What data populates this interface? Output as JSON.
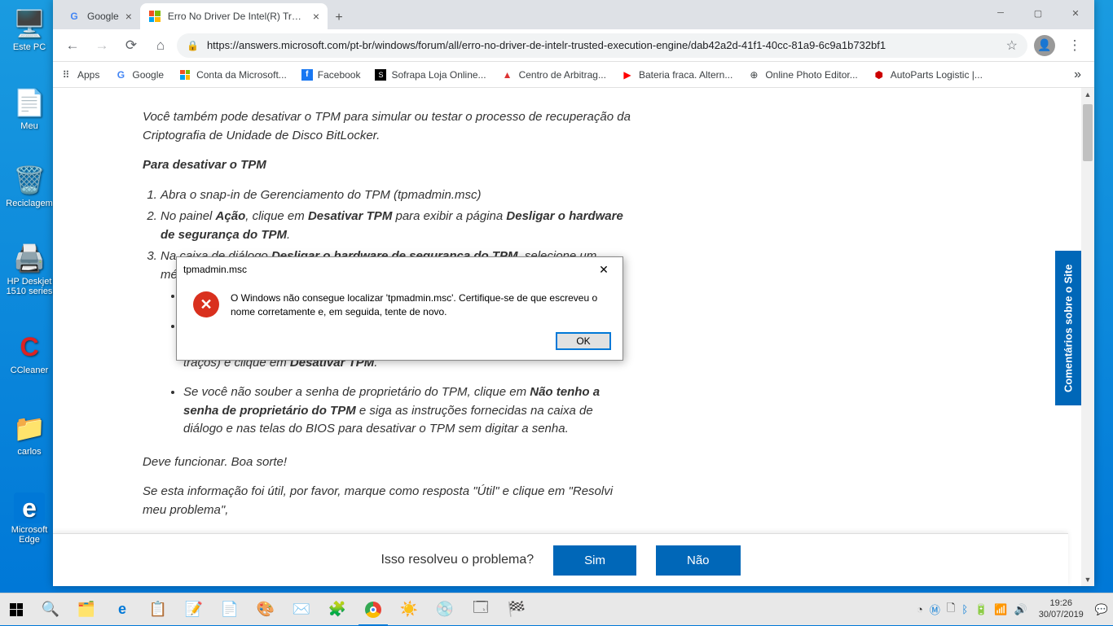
{
  "desktop_icons": [
    {
      "label": "Este PC",
      "glyph": "🖥️"
    },
    {
      "label": "Meu",
      "glyph": "📄"
    },
    {
      "label": "Reciclagem",
      "glyph": "🗑️"
    },
    {
      "label": "HP Deskjet 1510 series",
      "glyph": "🖨️"
    },
    {
      "label": "CCleaner",
      "glyph": "🧹"
    },
    {
      "label": "carlos",
      "glyph": "📁"
    },
    {
      "label": "Microsoft Edge",
      "glyph": "e"
    }
  ],
  "tabs": [
    {
      "title": "Google",
      "favicon": "G",
      "active": false
    },
    {
      "title": "Erro No Driver De Intel(R) Trustec",
      "favicon": "⊞",
      "active": true
    }
  ],
  "toolbar": {
    "url": "https://answers.microsoft.com/pt-br/windows/forum/all/erro-no-driver-de-intelr-trusted-execution-engine/dab42a2d-41f1-40cc-81a9-6c9a1b732bf1"
  },
  "bookmarks": [
    {
      "label": "Apps",
      "icon": "⠿"
    },
    {
      "label": "Google",
      "icon": "G"
    },
    {
      "label": "Conta da Microsoft...",
      "icon": "⊞"
    },
    {
      "label": "Facebook",
      "icon": "f"
    },
    {
      "label": "Sofrapa Loja Online...",
      "icon": "S"
    },
    {
      "label": "Centro de Arbitrag...",
      "icon": "▲"
    },
    {
      "label": "Bateria fraca. Altern...",
      "icon": "▶"
    },
    {
      "label": "Online Photo Editor...",
      "icon": "⊕"
    },
    {
      "label": "AutoParts Logistic |...",
      "icon": "⬢"
    }
  ],
  "article": {
    "p1": "Você também pode desativar o TPM para simular ou testar o processo de recuperação da Criptografia de Unidade de Disco BitLocker.",
    "h1": "Para desativar o TPM",
    "ol": [
      "Abra o snap-in de Gerenciamento do TPM (tpmadmin.msc)",
      "No painel <b>Ação</b>, clique em <b>Desativar TPM</b> para exibir a página <b>Desligar o hardware de segurança do TPM</b>.",
      "Na caixa de diálogo <b>Desligar o hardware de segurança do TPM</b>, selecione um método para inserir sua ... TPM."
    ],
    "bullets": [
      "... -a e clique ... de diálogo ... <b>rar</b> para ... <b>ativar TPM</b>.",
      "... clique em <b>Desejo digitar a senha de proprietário do TPM</b>. Na caixa de diálogo <b>Digite sua senha de proprietário do TPM</b>, digite sua senha (incluindo traços) e clique em <b>Desativar TPM</b>.",
      "Se você não souber a senha de proprietário do TPM, clique em <b>Não tenho a senha de proprietário do TPM</b> e siga as instruções fornecidas na caixa de diálogo e nas telas do BIOS para desativar o TPM sem digitar a senha."
    ],
    "p2": "Deve funcionar. Boa sorte!",
    "p3": "Se esta informação foi útil, por favor, marque como resposta \"Útil\" e clique em \"Resolvi meu problema\","
  },
  "feedback": {
    "question": "Isso resolveu o problema?",
    "yes": "Sim",
    "no": "Não"
  },
  "side_feedback": "Comentários sobre o Site",
  "dialog": {
    "title": "tpmadmin.msc",
    "message": "O Windows não consegue localizar 'tpmadmin.msc'. Certifique-se de que escreveu o nome corretamente e, em seguida, tente de novo.",
    "ok": "OK"
  },
  "clock": {
    "time": "19:26",
    "date": "30/07/2019"
  }
}
